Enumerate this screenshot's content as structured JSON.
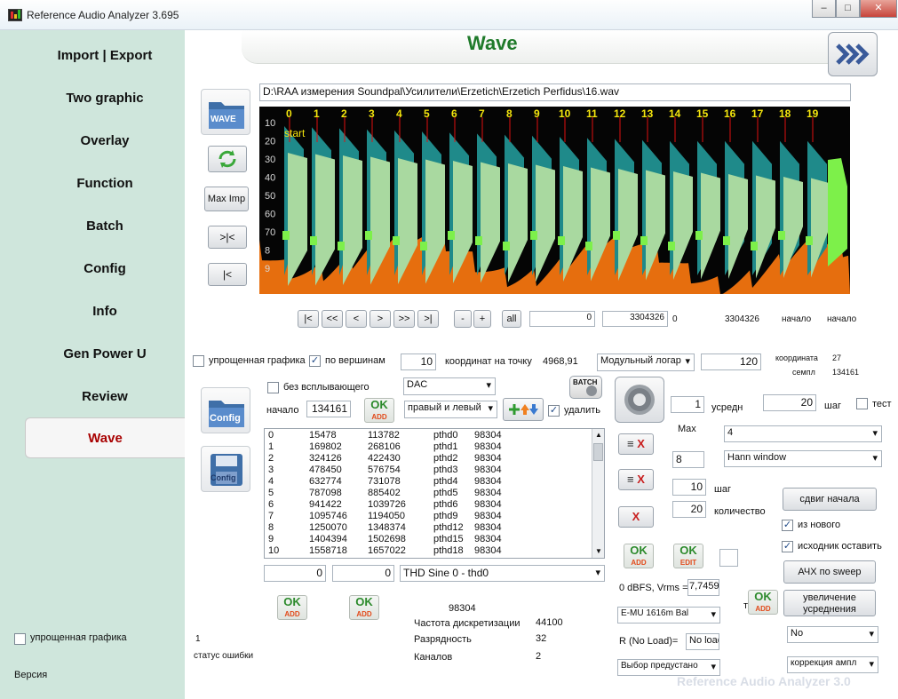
{
  "window": {
    "title": "Reference Audio Analyzer 3.695",
    "minimize": "–",
    "maximize": "□",
    "close": "✕"
  },
  "sidebar": {
    "items": [
      {
        "label": "Import | Export"
      },
      {
        "label": "Two graphic"
      },
      {
        "label": "Overlay"
      },
      {
        "label": "Function"
      },
      {
        "label": "Batch"
      },
      {
        "label": "Config"
      },
      {
        "label": "Info"
      },
      {
        "label": "Gen Power U"
      },
      {
        "label": "Review"
      },
      {
        "label": "Wave"
      }
    ],
    "simple_graph_label": "упрощенная графика",
    "version_label": "Версия"
  },
  "header": {
    "title": "Wave",
    "next_icon": "triple-chevron-right-icon"
  },
  "file": {
    "path": "D:\\RAA измерения Soundpal\\Усилители\\Erzetich\\Erzetich Perfidus\\16.wav"
  },
  "left_tools": {
    "wave_label": "WAVE",
    "max_imp": "Max Imp",
    "fit_label": ">|<",
    "start_label": "|<",
    "config_label": "Config",
    "config_save_label": "Config"
  },
  "chart": {
    "markers": [
      "0",
      "1",
      "2",
      "3",
      "4",
      "5",
      "6",
      "7",
      "8",
      "9",
      "10",
      "11",
      "12",
      "13",
      "14",
      "15",
      "16",
      "17",
      "18",
      "19"
    ],
    "y_labels": [
      "10",
      "20",
      "30",
      "40",
      "50",
      "60",
      "70",
      "8",
      "9"
    ],
    "start_label": "start",
    "colors": {
      "bg": "#050505",
      "teal": "#1f8a8a",
      "pale": "#a9d9a0",
      "green": "#7df04a",
      "orange": "#ff7a10",
      "yellow": "#f5e60d",
      "red": "#e01010"
    }
  },
  "nav": {
    "buttons": [
      "|<",
      "<<",
      "<",
      ">",
      ">>",
      ">|"
    ],
    "minus": "-",
    "plus": "+",
    "all": "all",
    "start_val": "0",
    "end_val": "3304326",
    "zero_lbl": "0",
    "total_lbl": "3304326",
    "begin1": "начало",
    "begin2": "начало"
  },
  "options": {
    "simple_graph": "упрощенная графика",
    "by_peaks": "по вершинам",
    "coords_val": "10",
    "coords_label": "координат на точку",
    "coords_val2": "4968,91",
    "mode_select": "Модульный логар",
    "mode_val": "120",
    "coord_lbl": "координата",
    "coord_num": "27",
    "sample_lbl": "семпл",
    "sample_num": "134161"
  },
  "controls": {
    "no_popup": "без всплывающего",
    "dac_select": "DAC",
    "batch_label": "BATCH",
    "begin_label": "начало",
    "begin_val": "134161",
    "ok_add": "OK",
    "add_sub": "ADD",
    "channel_select": "правый и левый",
    "delete_label": "удалить",
    "avg_val": "1",
    "avg_label": "усредн",
    "step_val": "20",
    "step_label": "шаг",
    "test_label": "тест",
    "max_label": "Max",
    "max_select": "4",
    "fft_val": "8",
    "window_select": "Hann window",
    "step2_val": "10",
    "step2_label": "шаг",
    "count_val": "20",
    "count_label": "количество",
    "shift_btn": "сдвиг начала",
    "from_new": "из нового",
    "keep_source": "исходник оставить",
    "ok_edit": "OK",
    "edit_sub": "EDIT",
    "freq_sweep": "АЧХ по sweep",
    "dbfs_label": "0 dBFS, Vrms =",
    "dbfs_val": "7,7459",
    "test2": "тест",
    "increase_avg_1": "увеличение",
    "increase_avg_2": "усреднения",
    "device_select": "E-MU 1616m Bal",
    "no_select": "No",
    "r_label": "R (No Load)=",
    "r_val": "No load",
    "preset_select": "Выбор предустано",
    "corr_select": "коррекция ампл"
  },
  "list": {
    "rows": [
      [
        "0",
        "15478",
        "113782",
        "pthd0",
        "98304"
      ],
      [
        "1",
        "169802",
        "268106",
        "pthd1",
        "98304"
      ],
      [
        "2",
        "324126",
        "422430",
        "pthd2",
        "98304"
      ],
      [
        "3",
        "478450",
        "576754",
        "pthd3",
        "98304"
      ],
      [
        "4",
        "632774",
        "731078",
        "pthd4",
        "98304"
      ],
      [
        "5",
        "787098",
        "885402",
        "pthd5",
        "98304"
      ],
      [
        "6",
        "941422",
        "1039726",
        "pthd6",
        "98304"
      ],
      [
        "7",
        "1095746",
        "1194050",
        "pthd9",
        "98304"
      ],
      [
        "8",
        "1250070",
        "1348374",
        "pthd12",
        "98304"
      ],
      [
        "9",
        "1404394",
        "1502698",
        "pthd15",
        "98304"
      ],
      [
        "10",
        "1558718",
        "1657022",
        "pthd18",
        "98304"
      ]
    ]
  },
  "bottom": {
    "val_a": "0",
    "val_b": "0",
    "signal_select": "THD Sine 0 - thd0",
    "count_val": "98304",
    "sr_label": "Частота дискретизации",
    "sr_val": "44100",
    "bits_label": "Разрядность",
    "bits_val": "32",
    "ch_label": "Каналов",
    "ch_val": "2",
    "status_num": "1",
    "status_label": "статус ошибки",
    "watermark": "Reference Audio Analyzer 3.0"
  }
}
